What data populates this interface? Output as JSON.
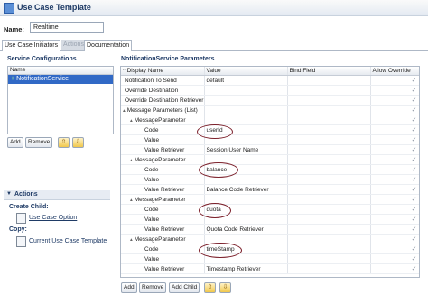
{
  "window": {
    "title": "Use Case Template"
  },
  "name_field": {
    "label": "Name:",
    "value": "Realtime"
  },
  "tabs": [
    {
      "label": "Use Case Initiators"
    },
    {
      "label": "Actions"
    },
    {
      "label": "Documentation"
    }
  ],
  "service_configurations": {
    "heading": "Service Configurations",
    "column": "Name",
    "items": [
      {
        "label": "NotificationService",
        "selected": true
      }
    ],
    "add_label": "Add",
    "remove_label": "Remove"
  },
  "actions": {
    "heading": "Actions",
    "create_child_label": "Create Child:",
    "create_child_link": "Use Case Option",
    "copy_label": "Copy:",
    "copy_link": "Current Use Case Template"
  },
  "params": {
    "heading": "NotificationService Parameters",
    "columns": {
      "display_name": "Display Name",
      "value": "Value",
      "bind_field": "Bind Field",
      "allow_override": "Allow Override"
    },
    "rows": [
      {
        "name": "Notification To Send",
        "value": "default"
      },
      {
        "name": "Override Destination",
        "value": ""
      },
      {
        "name": "Override Destination Retriever",
        "value": ""
      },
      {
        "name": "Message Parameters (List)",
        "value": ""
      },
      {
        "name": "MessageParameter",
        "value": ""
      },
      {
        "name": "Code",
        "value": "userId"
      },
      {
        "name": "Value",
        "value": ""
      },
      {
        "name": "Value Retriever",
        "value": "Session User Name"
      },
      {
        "name": "MessageParameter",
        "value": ""
      },
      {
        "name": "Code",
        "value": "balance"
      },
      {
        "name": "Value",
        "value": ""
      },
      {
        "name": "Value Retriever",
        "value": "Balance Code Retriever"
      },
      {
        "name": "MessageParameter",
        "value": ""
      },
      {
        "name": "Code",
        "value": "quota"
      },
      {
        "name": "Value",
        "value": ""
      },
      {
        "name": "Value Retriever",
        "value": "Quota Code Retriever"
      },
      {
        "name": "MessageParameter",
        "value": ""
      },
      {
        "name": "Code",
        "value": "timeStamp"
      },
      {
        "name": "Value",
        "value": ""
      },
      {
        "name": "Value Retriever",
        "value": "Timestamp Retriever"
      }
    ],
    "check_glyph": "✓",
    "add_label": "Add",
    "remove_label": "Remove",
    "add_child_label": "Add Child"
  },
  "colors": {
    "selection": "#3169c6",
    "annotation": "#7b1f2a",
    "heading": "#1f3b66"
  }
}
